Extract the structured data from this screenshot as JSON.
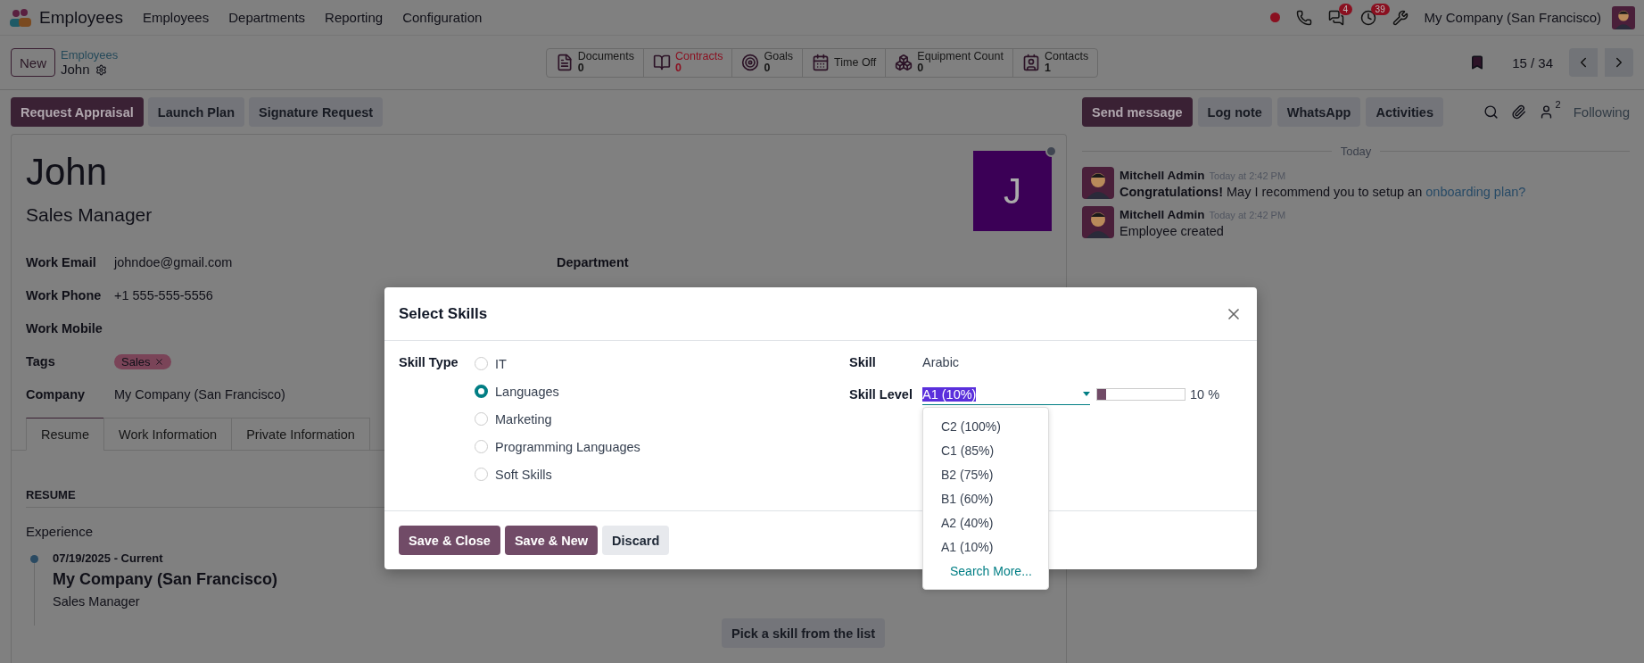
{
  "navbar": {
    "app": "Employees",
    "menus": [
      "Employees",
      "Departments",
      "Reporting",
      "Configuration"
    ],
    "systray": [
      {
        "kind": "status"
      },
      {
        "kind": "phone"
      },
      {
        "kind": "chat",
        "badge": "4"
      },
      {
        "kind": "activity",
        "badge": "39"
      },
      {
        "kind": "tools"
      }
    ],
    "company": "My Company (San Francisco)"
  },
  "control_panel": {
    "new_button": "New",
    "breadcrumb": "Employees",
    "record": "John",
    "smart_buttons": [
      {
        "kind": "documents",
        "label": "Documents",
        "value": "0",
        "alert": false
      },
      {
        "kind": "contracts",
        "label": "Contracts",
        "value": "0",
        "alert": true
      },
      {
        "kind": "goals",
        "label": "Goals",
        "value": "0",
        "alert": false
      },
      {
        "kind": "timeoff",
        "label": "Time Off",
        "alert": false
      },
      {
        "kind": "equipment",
        "label": "Equipment Count",
        "value": "0",
        "alert": false
      },
      {
        "kind": "contacts",
        "label": "Contacts",
        "value": "1",
        "alert": false
      }
    ],
    "pager": "15 / 34"
  },
  "actions": [
    {
      "label": "Request Appraisal",
      "kind": "primary"
    },
    {
      "label": "Launch Plan",
      "kind": "secondary"
    },
    {
      "label": "Signature Request",
      "kind": "secondary"
    }
  ],
  "form": {
    "name": "John",
    "job_title": "Sales Manager",
    "avatar": "J",
    "fields_left": [
      {
        "label": "Work Email",
        "value": "johndoe@gmail.com"
      },
      {
        "label": "Work Phone",
        "value": "+1 555-555-5556"
      },
      {
        "label": "Work Mobile"
      },
      {
        "label": "Tags",
        "tags": [
          "Sales"
        ]
      },
      {
        "label": "Company",
        "value": "My Company (San Francisco)"
      }
    ],
    "fields_right": [
      {
        "label": "Department"
      }
    ],
    "tabs": [
      {
        "label": "Resume",
        "selected": true
      },
      {
        "label": "Work Information",
        "selected": false
      },
      {
        "label": "Private Information",
        "selected": false
      }
    ],
    "resume": {
      "section": "RESUME",
      "group": "Experience",
      "entries": [
        {
          "dates": "07/19/2025 - Current",
          "title": "My Company (San Francisco)",
          "subtitle": "Sales Manager"
        }
      ]
    },
    "skills_button": "Pick a skill from the list"
  },
  "chatter": {
    "buttons": [
      {
        "label": "Send message",
        "kind": "primary"
      },
      {
        "label": "Log note",
        "kind": "secondary"
      },
      {
        "label": "WhatsApp",
        "kind": "secondary"
      },
      {
        "label": "Activities",
        "kind": "secondary"
      }
    ],
    "followers": "2",
    "following": "Following",
    "date": "Today",
    "messages": [
      {
        "author": "Mitchell Admin",
        "time": "Today at 2:42 PM",
        "body": "**Congratulations!** May I recommend you to setup an",
        "link": "onboarding plan?"
      },
      {
        "author": "Mitchell Admin",
        "time": "Today at 2:42 PM",
        "body": "Employee created"
      }
    ]
  },
  "dialog": {
    "title": "Select Skills",
    "skill_type_label": "Skill Type",
    "skill_types": [
      {
        "label": "IT",
        "selected": false
      },
      {
        "label": "Languages",
        "selected": true
      },
      {
        "label": "Marketing",
        "selected": false
      },
      {
        "label": "Programming Languages",
        "selected": false
      },
      {
        "label": "Soft Skills",
        "selected": false
      }
    ],
    "skill_label": "Skill",
    "skill": "Arabic",
    "level_label": "Skill Level",
    "level_value": "A1 (10%)",
    "level": 0.1,
    "level_reading": "10 %",
    "options": [
      "C2 (100%)",
      "C1 (85%)",
      "B2 (75%)",
      "B1 (60%)",
      "A2 (40%)",
      "A1 (10%)"
    ],
    "search_more": "Search More...",
    "buttons": [
      {
        "label": "Save & Close",
        "kind": "primary"
      },
      {
        "label": "Save & New",
        "kind": "primary"
      },
      {
        "label": "Discard",
        "kind": "secondary"
      }
    ]
  }
}
